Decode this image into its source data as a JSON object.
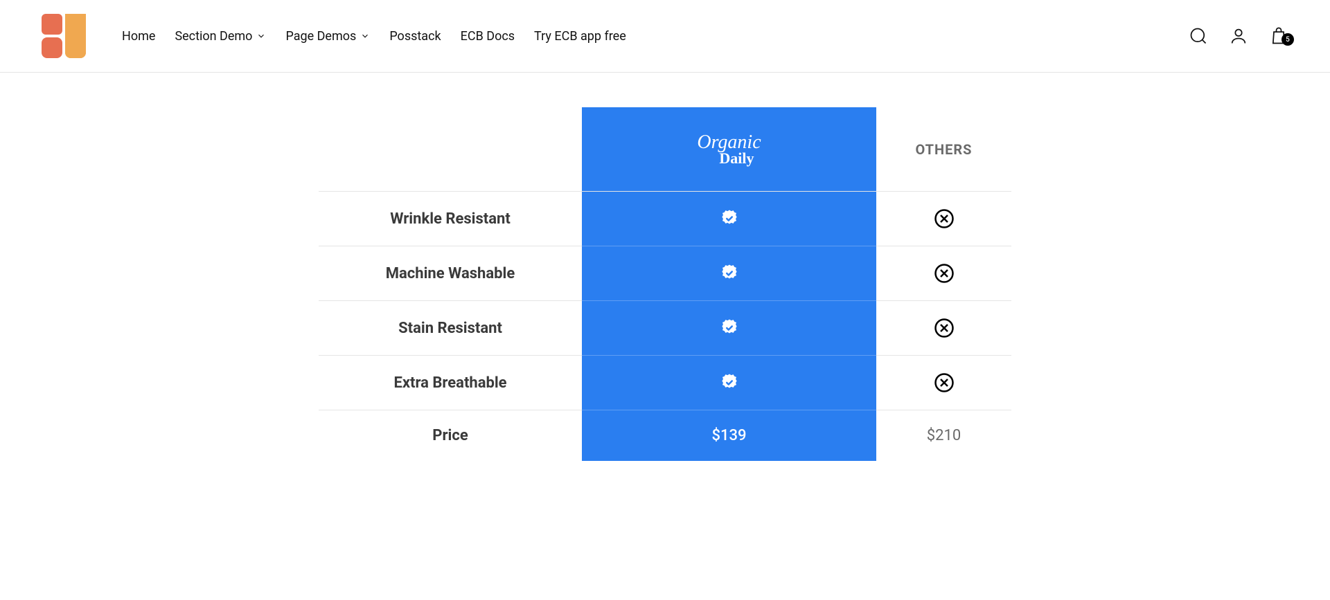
{
  "nav": {
    "items": [
      {
        "label": "Home",
        "hasDropdown": false
      },
      {
        "label": "Section Demo",
        "hasDropdown": true
      },
      {
        "label": "Page Demos",
        "hasDropdown": true
      },
      {
        "label": "Posstack",
        "hasDropdown": false
      },
      {
        "label": "ECB Docs",
        "hasDropdown": false
      },
      {
        "label": "Try ECB app free",
        "hasDropdown": false
      }
    ]
  },
  "cart": {
    "count": "5"
  },
  "comparison": {
    "brandName": {
      "line1": "Organic",
      "line2": "Daily"
    },
    "othersLabel": "OTHERS",
    "features": [
      {
        "label": "Wrinkle Resistant",
        "brand": true,
        "others": false
      },
      {
        "label": "Machine Washable",
        "brand": true,
        "others": false
      },
      {
        "label": "Stain Resistant",
        "brand": true,
        "others": false
      },
      {
        "label": "Extra Breathable",
        "brand": true,
        "others": false
      }
    ],
    "priceLabel": "Price",
    "brandPrice": "$139",
    "othersPrice": "$210"
  }
}
